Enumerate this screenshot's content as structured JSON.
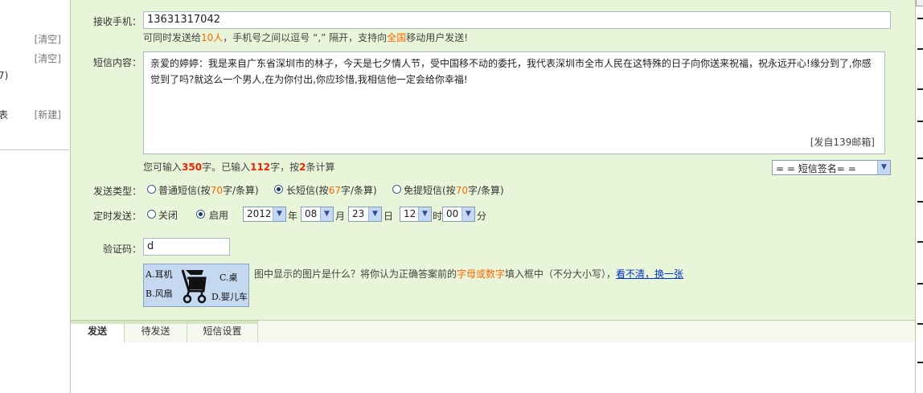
{
  "left": {
    "clear1": "[清空]",
    "clear2": "[清空]",
    "cut_count": "7)",
    "cut_char": "表",
    "new_link": "[新建]"
  },
  "form": {
    "recipient_label": "接收手机：",
    "recipient_value": "13631317042",
    "hint_parts": [
      "可同时发送给",
      "10人",
      "，手机号之间以逗号 “,” 隔开，支持向",
      "全国",
      "移动用户发送!"
    ],
    "content_label": "短信内容：",
    "content_text": "亲爱的婷婷：我是来自广东省深圳市的林子，今天是七夕情人节，受中国移不动的委托，我代表深圳市全市人民在这特殊的日子向你送来祝福，祝永远开心!缘分到了,你感觉到了吗?就这么一个男人,在为你付出,你应珍惜,我相信他一定会给你幸福!",
    "signature": "[发自139邮箱]",
    "count_parts": [
      "您可输入",
      "350",
      "字。已输入",
      "112",
      "字，按",
      "2",
      "条计算"
    ],
    "sign_select": "= = 短信签名= =",
    "type_label": "发送类型：",
    "type_options": [
      {
        "pre": "普通短信(按",
        "num": "70",
        "post": "字/条算)",
        "checked": false
      },
      {
        "pre": "长短信(按",
        "num": "67",
        "post": "字/条算)",
        "checked": true
      },
      {
        "pre": "免提短信(按",
        "num": "70",
        "post": "字/条算)",
        "checked": false
      }
    ],
    "timer_label": "定时发送：",
    "timer_off": "关闭",
    "timer_on": "启用",
    "year": "2012",
    "year_unit": "年",
    "month": "08",
    "month_unit": "月",
    "day": "23",
    "day_unit": "日",
    "hour": "12",
    "hour_unit": "时",
    "minute": "00",
    "minute_unit": "分",
    "captcha_label": "验证码：",
    "captcha_value": "d",
    "captcha_options": [
      "A.耳机",
      "B.风扇",
      "C.桌",
      "D.婴儿车"
    ],
    "captcha_hint_parts": [
      "图中显示的图片是什么？将你认为正确答案前的",
      "字母或数字",
      "填入框中（不分大小写），"
    ],
    "captcha_refresh": "看不清，换一张"
  },
  "tabs": [
    {
      "label": "发送",
      "active": true
    },
    {
      "label": "待发送",
      "active": false
    },
    {
      "label": "短信设置",
      "active": false
    }
  ],
  "colors": {
    "panel_bg": "#e9f5d9",
    "accent_orange": "#ff6600",
    "link_blue": "#0033cc"
  }
}
